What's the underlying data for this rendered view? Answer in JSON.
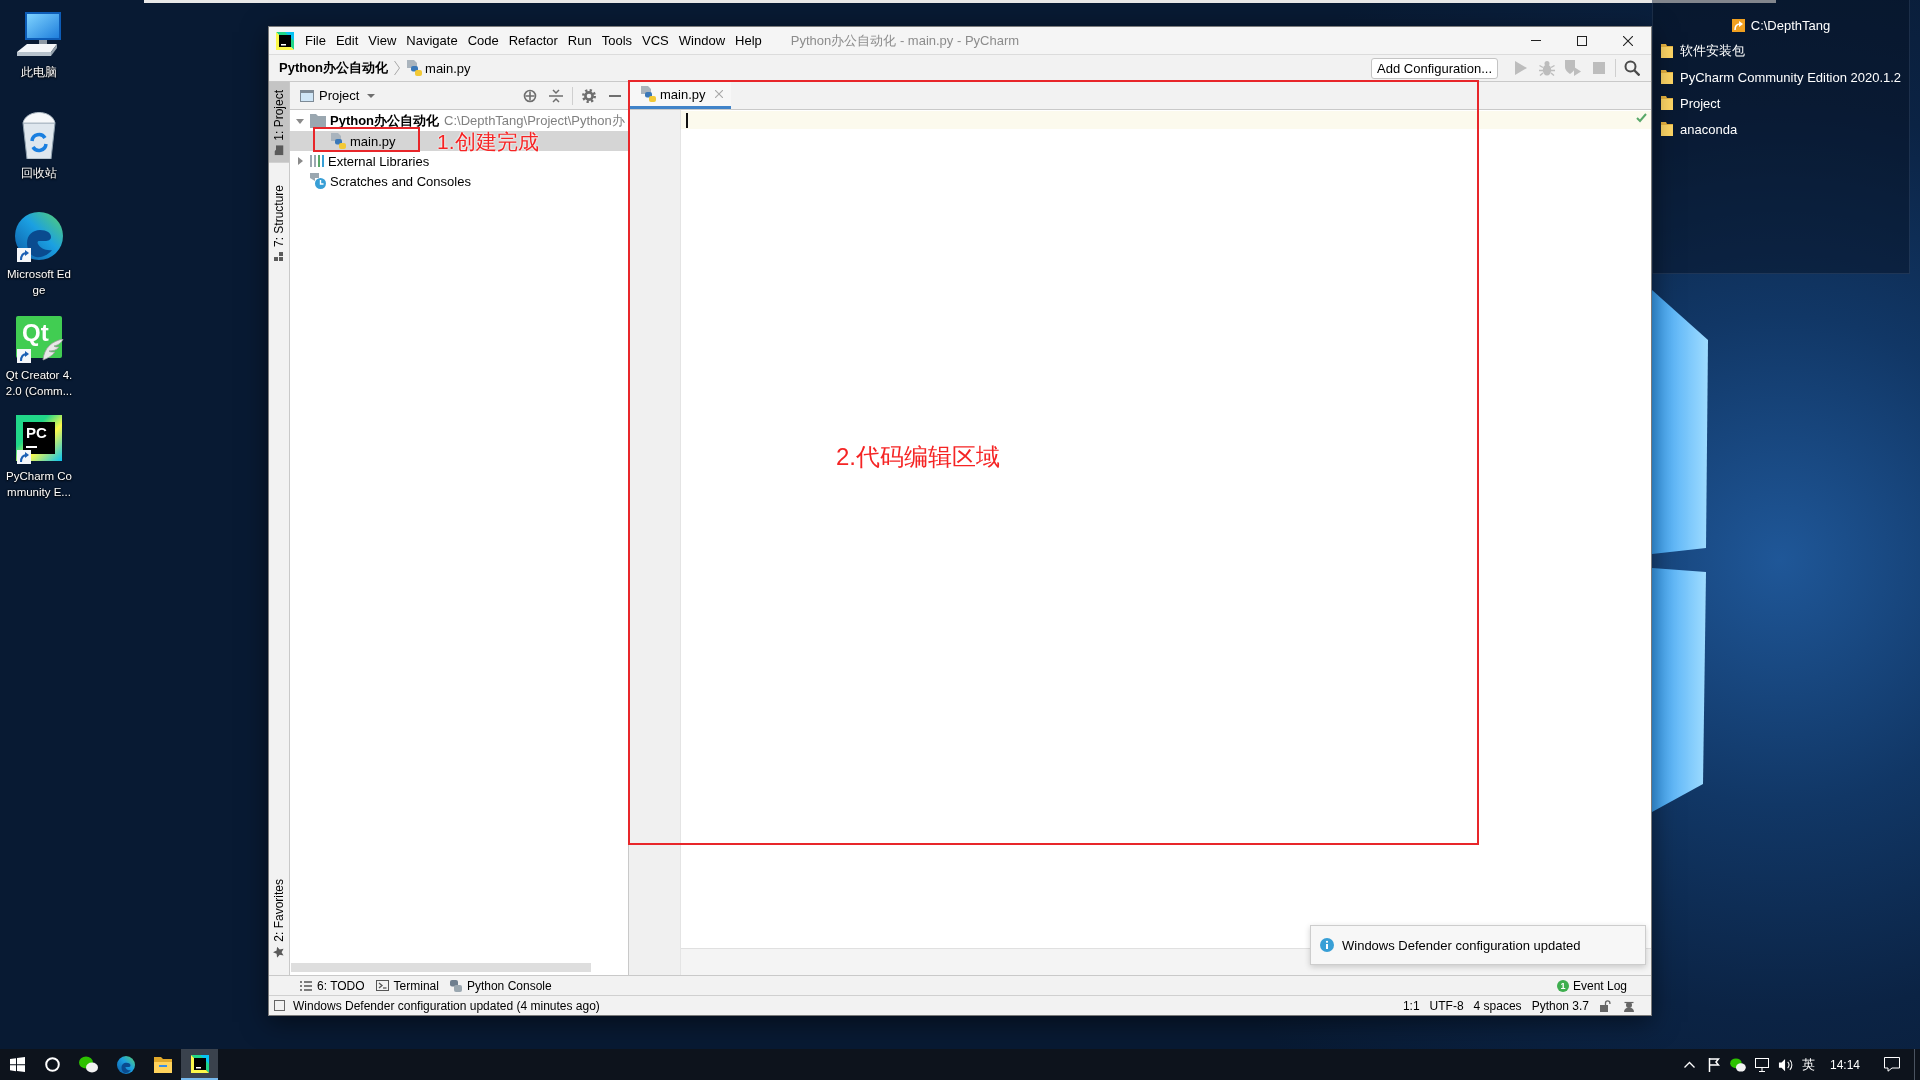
{
  "desktop": {
    "icons": [
      {
        "kind": "computer",
        "label": "此电脑",
        "shortcut": false
      },
      {
        "kind": "recycle-bin",
        "label": "回收站",
        "shortcut": false
      },
      {
        "kind": "edge",
        "label": "Microsoft Edge",
        "shortcut": true
      },
      {
        "kind": "qt",
        "label": "Qt Creator 4.2.0 (Comm...",
        "logo_text": "Qt",
        "shortcut": true
      },
      {
        "kind": "pycharm",
        "label": "PyCharm Community E...",
        "logo_text": "PC",
        "shortcut": true
      }
    ],
    "folder_panel": {
      "title": "C:\\DepthTang",
      "items": [
        "软件安装包",
        "PyCharm Community Edition 2020.1.2",
        "Project",
        "anaconda"
      ]
    }
  },
  "ide": {
    "title": "Python办公自动化 - main.py - PyCharm",
    "menu": [
      "File",
      "Edit",
      "View",
      "Navigate",
      "Code",
      "Refactor",
      "Run",
      "Tools",
      "VCS",
      "Window",
      "Help"
    ],
    "navbar": {
      "breadcrumb": [
        {
          "kind": "project",
          "label": "Python办公自动化"
        },
        {
          "kind": "python-file",
          "label": "main.py"
        }
      ],
      "config_button": "Add Configuration...",
      "actions": [
        {
          "kind": "run",
          "disabled": true
        },
        {
          "kind": "debug",
          "disabled": true
        },
        {
          "kind": "coverage",
          "disabled": true
        },
        {
          "kind": "stop",
          "disabled": true
        },
        {
          "kind": "search",
          "disabled": false
        }
      ]
    },
    "left_stripe": [
      {
        "kind": "project",
        "label": "1: Project",
        "selected": true
      },
      {
        "kind": "structure",
        "label": "7: Structure",
        "selected": false
      },
      {
        "kind": "favorites",
        "label": "2: Favorites",
        "selected": false
      }
    ],
    "project_panel": {
      "title": "Project",
      "tree": [
        {
          "kind": "project",
          "label": "Python办公自动化",
          "path": "C:\\DepthTang\\Project\\Python办",
          "expanded": true,
          "selected": false,
          "children": [
            {
              "kind": "python-file",
              "label": "main.py",
              "selected": true
            }
          ]
        },
        {
          "kind": "libraries",
          "label": "External Libraries",
          "expanded": false,
          "selected": false
        },
        {
          "kind": "scratches",
          "label": "Scratches and Consoles",
          "selected": false
        }
      ],
      "annotation": "1.创建完成"
    },
    "editor": {
      "tabs": [
        {
          "label": "main.py",
          "selected": true
        }
      ],
      "annotation": "2.代码编辑区域",
      "notification": "Windows Defender configuration updated"
    },
    "bottom_tools": [
      {
        "kind": "todo",
        "label": "6: TODO"
      },
      {
        "kind": "terminal",
        "label": "Terminal"
      },
      {
        "kind": "python-console",
        "label": "Python Console"
      }
    ],
    "event_log": {
      "label": "Event Log",
      "badge": "1"
    },
    "status_bar": {
      "message": "Windows Defender configuration updated (4 minutes ago)",
      "items": [
        "1:1",
        "UTF-8",
        "4 spaces",
        "Python 3.7"
      ]
    }
  },
  "taskbar": {
    "apps": [
      {
        "kind": "wechat",
        "active": false
      },
      {
        "kind": "edge",
        "active": false
      },
      {
        "kind": "explorer",
        "active": false
      },
      {
        "kind": "pycharm",
        "active": true
      }
    ],
    "tray": {
      "input_mode": "英",
      "time": "14:14"
    }
  }
}
